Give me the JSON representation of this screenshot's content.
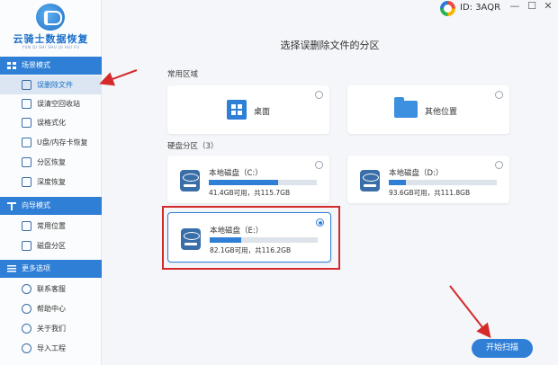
{
  "app": {
    "logo_text": "云骑士数据恢复",
    "logo_sub": "YUN QI SHI SHU JU HUI FU",
    "user_id": "ID: 3AQR",
    "window_controls": [
      "—",
      "☐",
      "✕"
    ]
  },
  "sidebar": {
    "sections": [
      {
        "label": "场景模式",
        "icon": "grid-icon"
      },
      {
        "label": "向导模式",
        "icon": "signpost-icon"
      },
      {
        "label": "更多选项",
        "icon": "menu-icon"
      }
    ],
    "scene_items": [
      {
        "label": "误删除文件",
        "active": true,
        "icon": "deleted-file-icon"
      },
      {
        "label": "误清空回收站",
        "active": false,
        "icon": "recycle-bin-icon"
      },
      {
        "label": "误格式化",
        "active": false,
        "icon": "format-icon"
      },
      {
        "label": "U盘/内存卡恢复",
        "active": false,
        "icon": "usb-icon"
      },
      {
        "label": "分区恢复",
        "active": false,
        "icon": "partition-icon"
      },
      {
        "label": "深度恢复",
        "active": false,
        "icon": "deep-scan-icon"
      }
    ],
    "wizard_items": [
      {
        "label": "常用位置",
        "icon": "location-icon"
      },
      {
        "label": "磁盘分区",
        "icon": "disk-partition-icon"
      }
    ],
    "more_items": [
      {
        "label": "联系客服",
        "icon": "support-icon"
      },
      {
        "label": "帮助中心",
        "icon": "help-icon"
      },
      {
        "label": "关于我们",
        "icon": "info-icon"
      },
      {
        "label": "导入工程",
        "icon": "import-icon"
      }
    ]
  },
  "main": {
    "title": "选择误删除文件的分区",
    "common_label": "常用区域",
    "common_cards": [
      {
        "label": "桌面",
        "icon": "desktop-icon",
        "selected": false
      },
      {
        "label": "其他位置",
        "icon": "folder-icon",
        "selected": false
      }
    ],
    "disk_label": "硬盘分区（3）",
    "disks": [
      {
        "name": "本地磁盘（C:）",
        "size": "41.4GB可用，共115.7GB",
        "used_fraction": 0.64,
        "selected": false
      },
      {
        "name": "本地磁盘（D:）",
        "size": "93.6GB可用，共111.8GB",
        "used_fraction": 0.16,
        "selected": false
      },
      {
        "name": "本地磁盘（E:）",
        "size": "82.1GB可用，共116.2GB",
        "used_fraction": 0.29,
        "selected": true
      }
    ],
    "scan_button": "开始扫描"
  },
  "colors": {
    "accent": "#2f7fd6",
    "annotation": "#d42a2a"
  }
}
